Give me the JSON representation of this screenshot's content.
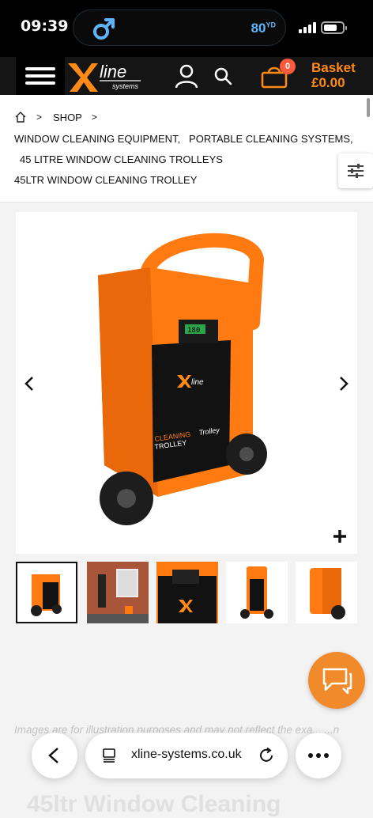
{
  "status_bar": {
    "time": "09:39",
    "activity_value": "80",
    "activity_unit": "YD"
  },
  "header": {
    "logo_text": "line",
    "logo_sub": "systems",
    "basket_count": "0",
    "basket_label": "Basket",
    "basket_total": "£0.00"
  },
  "breadcrumb": {
    "shop": "SHOP",
    "cat1": "WINDOW CLEANING EQUIPMENT,",
    "cat2": "PORTABLE CLEANING SYSTEMS,",
    "cat3": "45 LITRE WINDOW CLEANING TROLLEYS",
    "current": "45LTR WINDOW CLEANING TROLLEY"
  },
  "gallery": {
    "panel_readout": "180",
    "panel_logo": "line",
    "cleaning_word": "CLEANING",
    "trolley_word": "TROLLEY",
    "trolley_badge": "Trolley"
  },
  "disclaimer": "Images are for illustration purposes and may not reflect the exa... ...n",
  "product_title": "45ltr Window Cleaning",
  "browser": {
    "url": "xline-systems.co.uk"
  },
  "colors": {
    "brand_orange": "#ff8a16",
    "accent": "#f18a2a",
    "header_bg": "#151515"
  }
}
